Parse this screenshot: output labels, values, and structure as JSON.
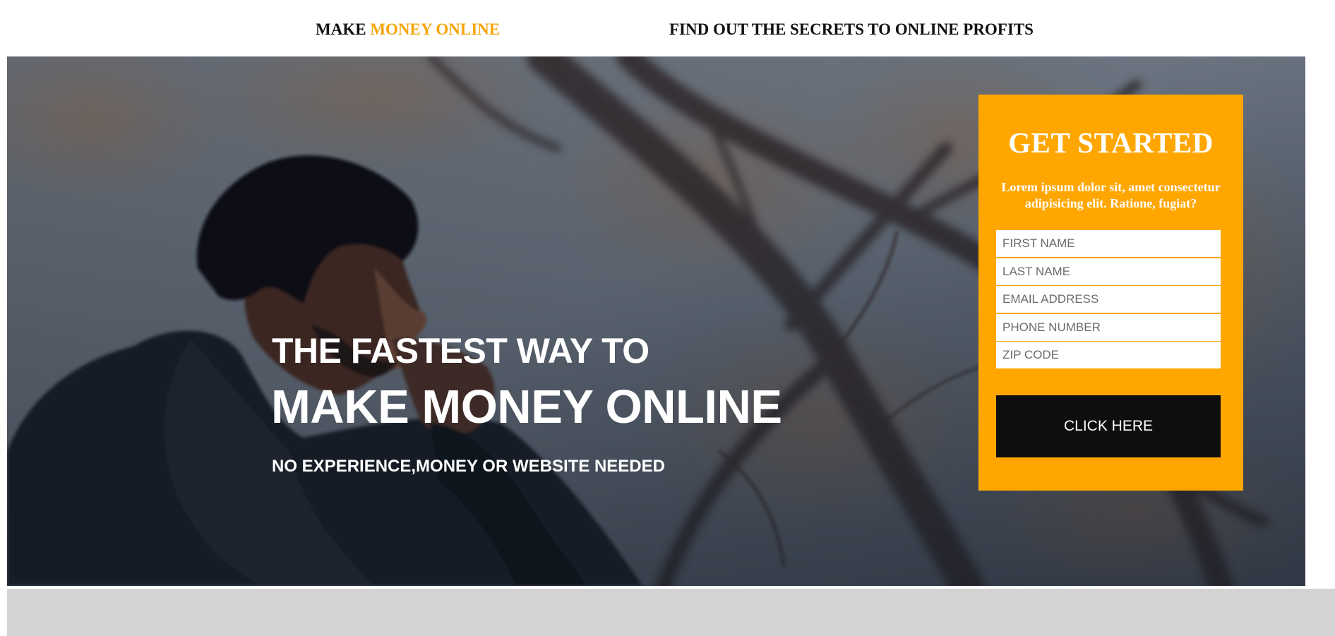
{
  "header": {
    "brand_prefix": "MAKE",
    "brand_accent": "MONEY ONLINE",
    "tagline": "FIND OUT THE SECRETS TO ONLINE PROFITS"
  },
  "hero": {
    "headline_1": "THE FASTEST WAY TO",
    "headline_2": "MAKE MONEY ONLINE",
    "subline": "NO EXPERIENCE,MONEY OR WEBSITE NEEDED"
  },
  "form": {
    "title": "GET STARTED",
    "text": "Lorem ipsum dolor sit, amet consectetur adipisicing elit. Ratione, fugiat?",
    "first_name_placeholder": "FIRST NAME",
    "last_name_placeholder": "LAST NAME",
    "email_placeholder": "EMAIL ADDRESS",
    "phone_placeholder": "PHONE NUMBER",
    "zip_placeholder": "ZIP CODE",
    "button_label": "CLICK HERE"
  },
  "colors": {
    "accent": "#ffa600",
    "brand_accent_text": "#f5a50a",
    "button": "#0e0e0e",
    "bottom_band": "#d3d3d3"
  }
}
